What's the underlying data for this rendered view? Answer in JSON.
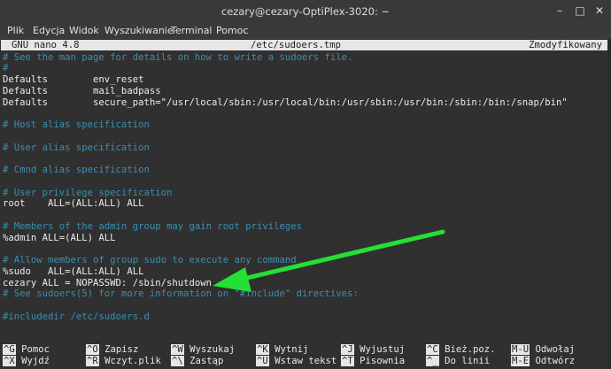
{
  "window": {
    "title": "cezary@cezary-OptiPlex-3020: ~",
    "controls": [
      "–",
      "□",
      "✕"
    ]
  },
  "menu": [
    "Plik",
    "Edycja",
    "Widok",
    "Wyszukiwanie",
    "Terminal",
    "Pomoc"
  ],
  "nano": {
    "version": "GNU nano 4.8",
    "file": "/etc/sudoers.tmp",
    "status": "Zmodyfikowany"
  },
  "lines": [
    {
      "text": "# See the man page for details on how to write a sudoers file.",
      "kind": "comment"
    },
    {
      "text": "#",
      "kind": "comment"
    },
    {
      "text": "Defaults        env_reset",
      "kind": "text"
    },
    {
      "text": "Defaults        mail_badpass",
      "kind": "text"
    },
    {
      "text": "Defaults        secure_path=\"/usr/local/sbin:/usr/local/bin:/usr/sbin:/usr/bin:/sbin:/bin:/snap/bin\"",
      "kind": "text"
    },
    {
      "text": "",
      "kind": "text"
    },
    {
      "text": "# Host alias specification",
      "kind": "comment"
    },
    {
      "text": "",
      "kind": "text"
    },
    {
      "text": "# User alias specification",
      "kind": "comment"
    },
    {
      "text": "",
      "kind": "text"
    },
    {
      "text": "# Cmnd alias specification",
      "kind": "comment"
    },
    {
      "text": "",
      "kind": "text"
    },
    {
      "text": "# User privilege specification",
      "kind": "comment"
    },
    {
      "text": "root    ALL=(ALL:ALL) ALL",
      "kind": "text"
    },
    {
      "text": "",
      "kind": "text"
    },
    {
      "text": "# Members of the admin group may gain root privileges",
      "kind": "comment"
    },
    {
      "text": "%admin ALL=(ALL) ALL",
      "kind": "text"
    },
    {
      "text": "",
      "kind": "text"
    },
    {
      "text": "# Allow members of group sudo to execute any command",
      "kind": "comment"
    },
    {
      "text": "%sudo   ALL=(ALL:ALL) ALL",
      "kind": "text"
    },
    {
      "text": "cezary ALL = NOPASSWD: /sbin/shutdown",
      "kind": "text"
    },
    {
      "text": "# See sudoers(5) for more information on \"#include\" directives:",
      "kind": "comment"
    },
    {
      "text": "",
      "kind": "text"
    },
    {
      "text": "#includedir /etc/sudoers.d",
      "kind": "comment"
    }
  ],
  "shortcuts_row1": [
    {
      "key": "^G",
      "label": "Pomoc"
    },
    {
      "key": "^O",
      "label": "Zapisz"
    },
    {
      "key": "^W",
      "label": "Wyszukaj"
    },
    {
      "key": "^K",
      "label": "Wytnij"
    },
    {
      "key": "^J",
      "label": "Wyjustuj"
    },
    {
      "key": "^C",
      "label": "Bież.poz."
    },
    {
      "key": "M-U",
      "label": "Odwołaj"
    }
  ],
  "shortcuts_row2": [
    {
      "key": "^X",
      "label": "Wyjdź"
    },
    {
      "key": "^R",
      "label": "Wczyt.plik"
    },
    {
      "key": "^\\",
      "label": "Zastąp"
    },
    {
      "key": "^U",
      "label": "Wstaw tekst"
    },
    {
      "key": "^T",
      "label": "Pisownia"
    },
    {
      "key": "^_",
      "label": "Do linii"
    },
    {
      "key": "M-E",
      "label": "Odtwórz"
    }
  ],
  "colors": {
    "comment": "#3c8eaf",
    "text": "#ececec",
    "arrow": "#22e034"
  }
}
